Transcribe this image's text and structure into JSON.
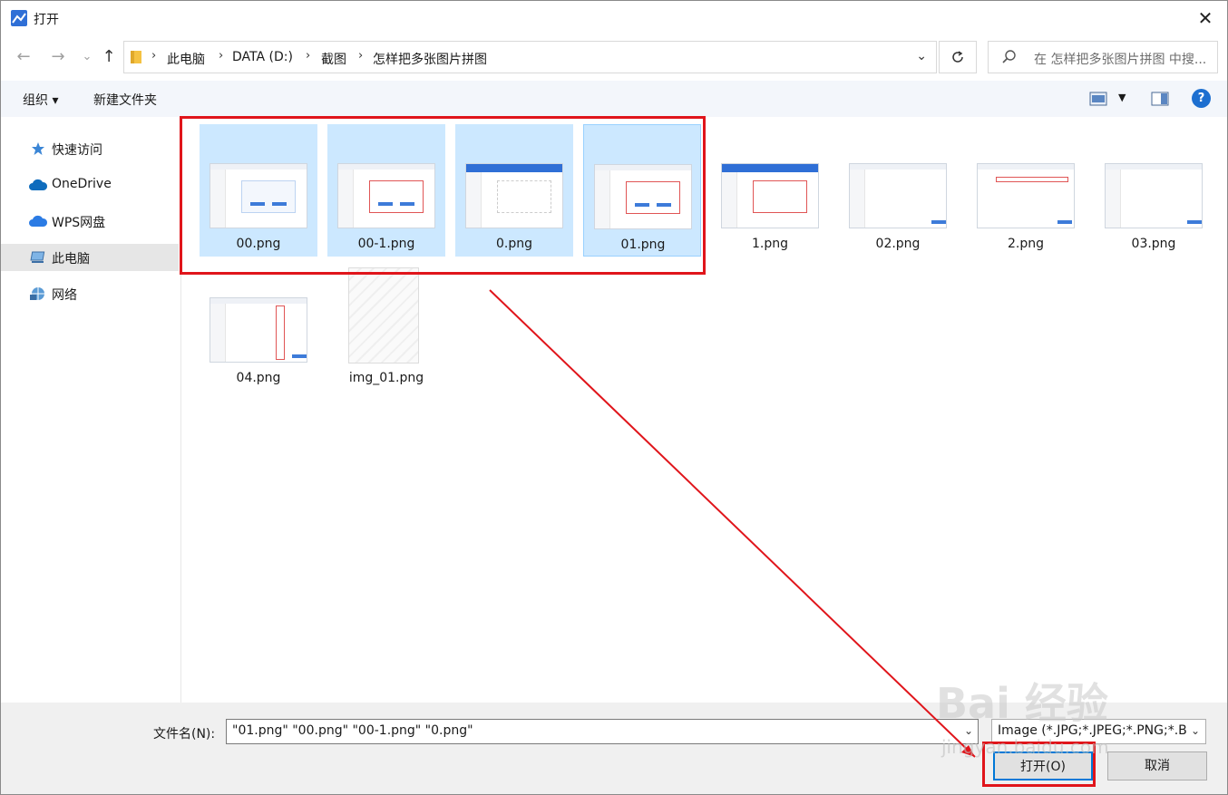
{
  "window": {
    "title": "打开",
    "close": "✕"
  },
  "nav": {
    "back": "←",
    "forward": "→",
    "recent": "⌄",
    "up": "↑",
    "breadcrumbs": [
      "此电脑",
      "DATA (D:)",
      "截图",
      "怎样把多张图片拼图"
    ],
    "search_placeholder": "在 怎样把多张图片拼图 中搜..."
  },
  "toolbar": {
    "organize": "组织 ▾",
    "new_folder": "新建文件夹",
    "help": "?"
  },
  "sidebar": {
    "items": [
      {
        "label": "快速访问",
        "icon": "star-icon"
      },
      {
        "label": "OneDrive",
        "icon": "cloud-icon"
      },
      {
        "label": "WPS网盘",
        "icon": "cloud-icon"
      },
      {
        "label": "此电脑",
        "icon": "computer-icon",
        "selected": true
      },
      {
        "label": "网络",
        "icon": "network-icon"
      }
    ]
  },
  "files": [
    {
      "name": "00.png",
      "selected": true
    },
    {
      "name": "00-1.png",
      "selected": true
    },
    {
      "name": "0.png",
      "selected": true
    },
    {
      "name": "01.png",
      "selected": true
    },
    {
      "name": "1.png",
      "selected": false
    },
    {
      "name": "02.png",
      "selected": false
    },
    {
      "name": "2.png",
      "selected": false
    },
    {
      "name": "03.png",
      "selected": false
    },
    {
      "name": "04.png",
      "selected": false
    },
    {
      "name": "img_01.png",
      "selected": false
    }
  ],
  "bottom": {
    "filename_label": "文件名(N):",
    "filename_value": "\"01.png\" \"00.png\" \"00-1.png\" \"0.png\"",
    "filter_value": "Image (*.JPG;*.JPEG;*.PNG;*.B",
    "open_button": "打开(O)",
    "cancel_button": "取消"
  },
  "watermark": {
    "text": "Bai 经验",
    "sub": "jingyan.baidu.com"
  },
  "colors": {
    "highlight": "#e0151b",
    "selection": "#cce8ff",
    "accent": "#0078d7"
  }
}
